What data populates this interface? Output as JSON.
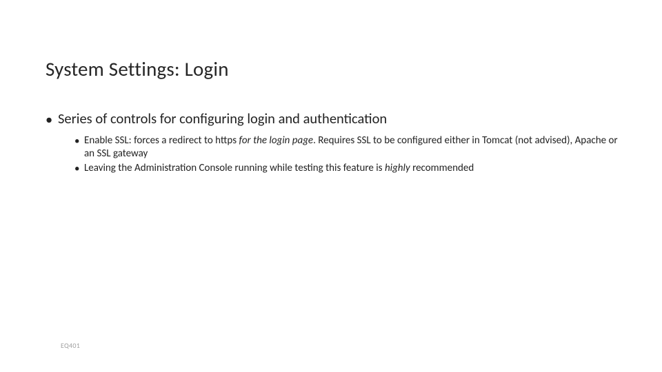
{
  "title": "System Settings: Login",
  "bullets": {
    "level1": {
      "text": "Series of controls for configuring login and authentication"
    },
    "level2": [
      {
        "prefix": "Enable SSL:  forces a redirect to https ",
        "italic1": "for the login page",
        "mid": ".  Requires SSL to be configured either in Tomcat (not advised), Apache or an SSL gateway"
      },
      {
        "prefix": "Leaving the Administration Console running while testing this feature is ",
        "italic1": "highly",
        "mid": " recommended"
      }
    ]
  },
  "footer": "EQ401"
}
